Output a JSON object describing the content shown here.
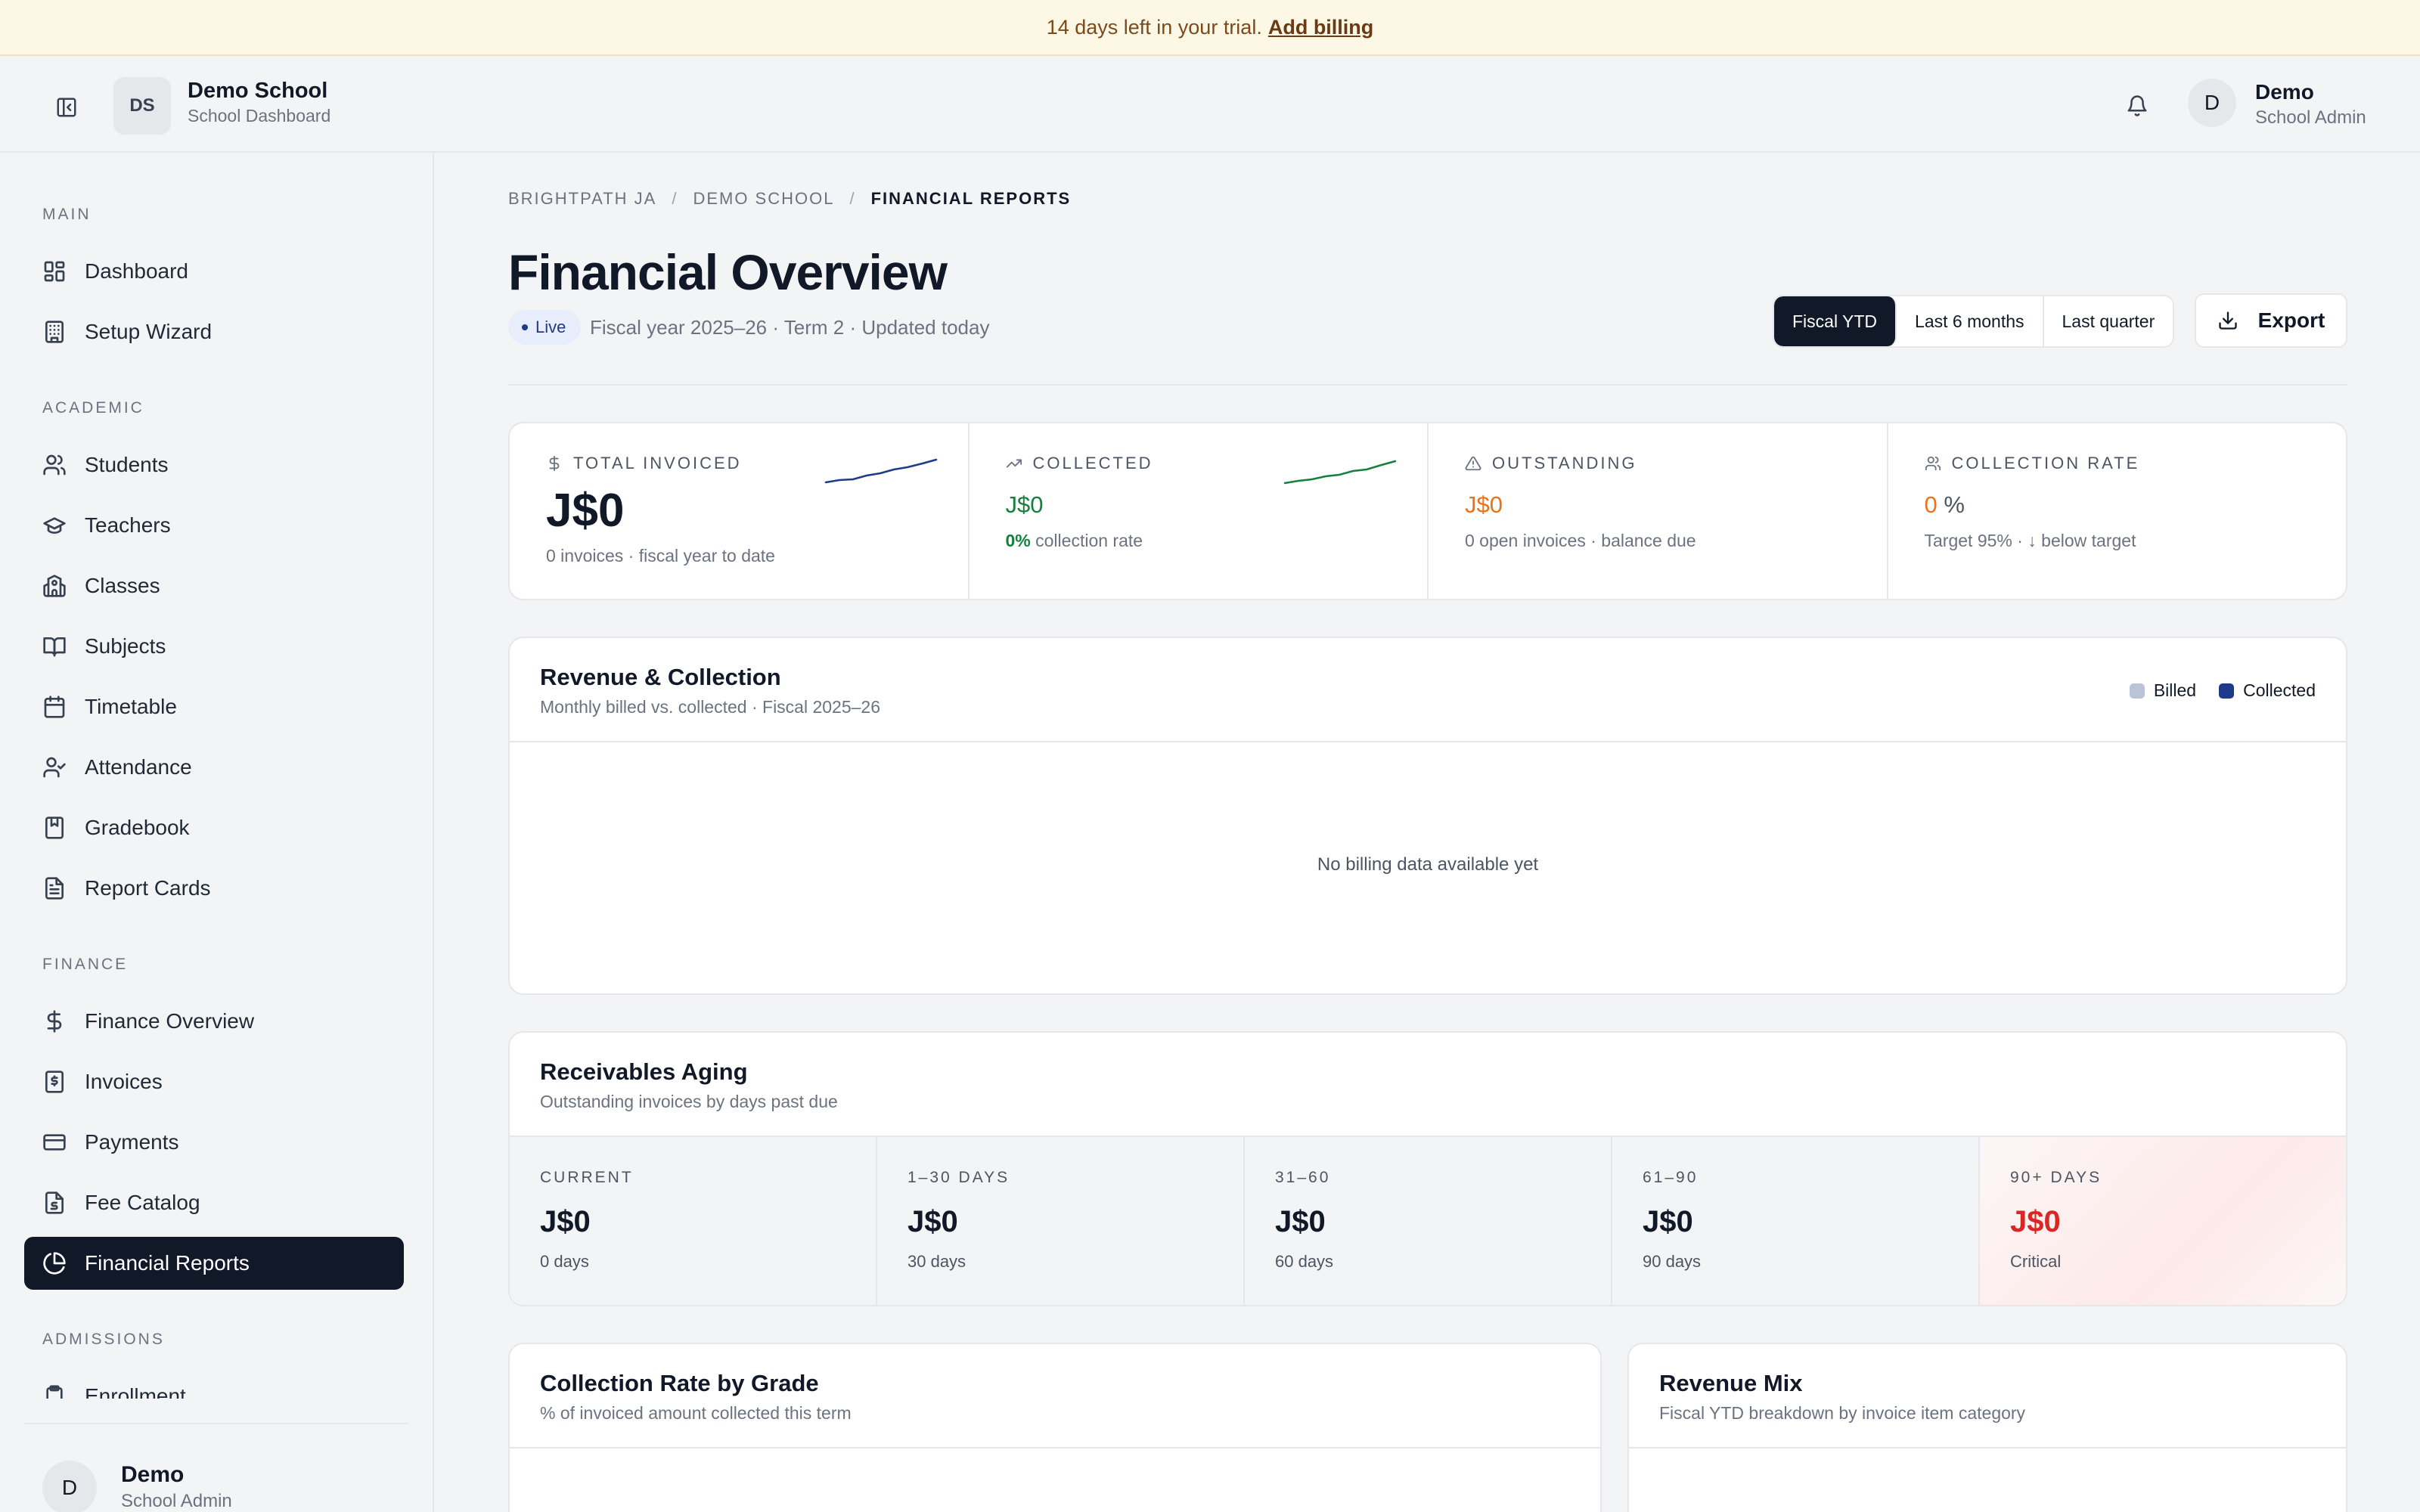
{
  "banner": {
    "text": "14 days left in your trial.",
    "link": "Add billing"
  },
  "header": {
    "school_initials": "DS",
    "school_name": "Demo School",
    "school_subtitle": "School Dashboard",
    "user_initial": "D",
    "user_name": "Demo",
    "user_role": "School Admin"
  },
  "sidebar": {
    "sections": {
      "main": "MAIN",
      "academic": "ACADEMIC",
      "finance": "FINANCE",
      "admissions": "ADMISSIONS"
    },
    "items": {
      "dashboard": "Dashboard",
      "setup_wizard": "Setup Wizard",
      "students": "Students",
      "teachers": "Teachers",
      "classes": "Classes",
      "subjects": "Subjects",
      "timetable": "Timetable",
      "attendance": "Attendance",
      "gradebook": "Gradebook",
      "report_cards": "Report Cards",
      "finance_overview": "Finance Overview",
      "invoices": "Invoices",
      "payments": "Payments",
      "fee_catalog": "Fee Catalog",
      "financial_reports": "Financial Reports",
      "enrollment": "Enrollment"
    },
    "footer": {
      "initial": "D",
      "name": "Demo",
      "role": "School Admin"
    }
  },
  "breadcrumb": [
    "BRIGHTPATH JA",
    "/",
    "DEMO SCHOOL",
    "/",
    "FINANCIAL REPORTS"
  ],
  "page": {
    "title": "Financial Overview",
    "live_badge": "Live",
    "meta": "Fiscal year 2025–26 · Term 2 · Updated today",
    "ranges": [
      "Fiscal YTD",
      "Last 6 months",
      "Last quarter"
    ],
    "export_label": "Export"
  },
  "kpis": {
    "total_invoiced": {
      "label": "TOTAL INVOICED",
      "value": "J$0",
      "sub": "0 invoices · fiscal year to date"
    },
    "collected": {
      "label": "COLLECTED",
      "value": "J$0",
      "rate": "0%",
      "rate_text": "collection rate"
    },
    "outstanding": {
      "label": "OUTSTANDING",
      "value": "J$0",
      "sub": "0 open invoices · balance due"
    },
    "collection_rate": {
      "label": "COLLECTION RATE",
      "value": "0",
      "unit": "%",
      "sub": "Target 95% · ↓ below target"
    }
  },
  "revenue": {
    "title": "Revenue & Collection",
    "subtitle": "Monthly billed vs. collected · Fiscal 2025–26",
    "legend": {
      "billed": "Billed",
      "collected": "Collected"
    },
    "colors": {
      "billed": "#b9c4d6",
      "collected": "#1e3a8a"
    },
    "empty_text": "No billing data available yet"
  },
  "aging": {
    "title": "Receivables Aging",
    "subtitle": "Outstanding invoices by days past due",
    "buckets": [
      {
        "label": "CURRENT",
        "value": "J$0",
        "sub": "0 days"
      },
      {
        "label": "1–30 DAYS",
        "value": "J$0",
        "sub": "30 days"
      },
      {
        "label": "31–60",
        "value": "J$0",
        "sub": "60 days"
      },
      {
        "label": "61–90",
        "value": "J$0",
        "sub": "90 days"
      },
      {
        "label": "90+ DAYS",
        "value": "J$0",
        "sub": "Critical"
      }
    ]
  },
  "grade_card": {
    "title": "Collection Rate by Grade",
    "subtitle": "% of invoiced amount collected this term"
  },
  "mix_card": {
    "title": "Revenue Mix",
    "subtitle": "Fiscal YTD breakdown by invoice item category"
  },
  "accent_colors": {
    "green": "#15803d",
    "orange": "#ea7317",
    "red": "#dc2626",
    "dark": "#111827"
  }
}
